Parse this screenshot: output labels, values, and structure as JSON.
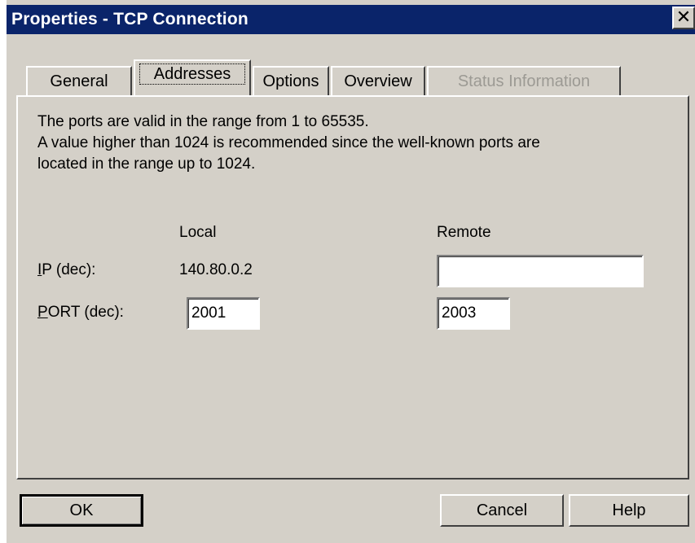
{
  "window": {
    "title": "Properties - TCP Connection",
    "close_glyph": "✕"
  },
  "tabs": [
    {
      "label": "General",
      "state": "normal"
    },
    {
      "label": "Addresses",
      "state": "active"
    },
    {
      "label": "Options",
      "state": "normal"
    },
    {
      "label": "Overview",
      "state": "normal"
    },
    {
      "label": "Status Information",
      "state": "disabled"
    }
  ],
  "info": {
    "line1": "The ports are valid in the range from 1 to 65535.",
    "line2": "A value higher than 1024 is recommended since the well-known ports are",
    "line3": "located in the range up to 1024."
  },
  "columns": {
    "local": "Local",
    "remote": "Remote"
  },
  "ip": {
    "mnemonic": "I",
    "label_rest": "P (dec):",
    "local_value": "140.80.0.2",
    "remote_value": ""
  },
  "port": {
    "mnemonic": "P",
    "label_rest": "ORT (dec):",
    "local_value": "2001",
    "remote_value": "2003"
  },
  "buttons": {
    "ok": "OK",
    "cancel": "Cancel",
    "help": "Help"
  },
  "colors": {
    "titlebar": "#0a246a",
    "face": "#d4d0c8",
    "disabled_text": "#9c9a94"
  }
}
